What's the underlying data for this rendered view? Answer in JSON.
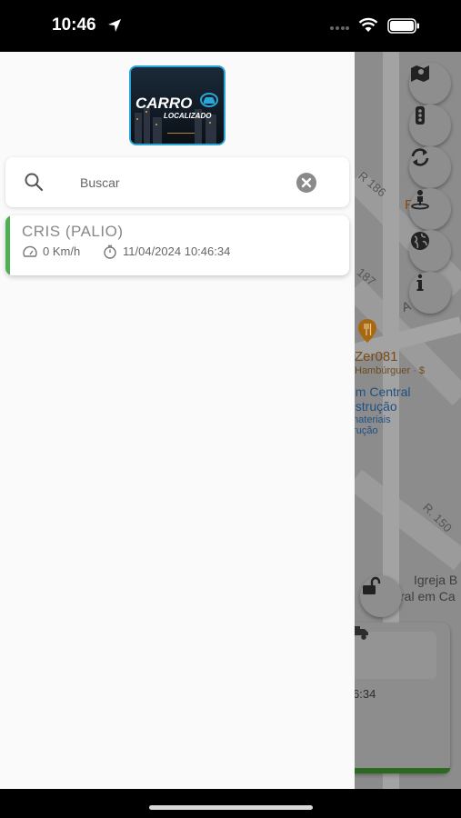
{
  "status_bar": {
    "time": "10:46",
    "icons": [
      "location-arrow-icon",
      "signal-dots-icon",
      "wifi-icon",
      "battery-icon"
    ]
  },
  "drawer": {
    "logo": {
      "line1": "CARRO",
      "line2": "LOCALIZADO"
    },
    "search": {
      "placeholder": "Buscar",
      "value": ""
    },
    "vehicles": [
      {
        "name": "CRIS (PALIO)",
        "speed": "0 Km/h",
        "last_update": "11/04/2024 10:46:34",
        "status_color": "#4caf50"
      }
    ]
  },
  "map": {
    "labels": {
      "street_186": "R 186",
      "street_187": "187",
      "street_150": "R. 150",
      "poi_name": "Zer081",
      "poi_category": "Hambúrguer · $",
      "place_line1": "ém Central",
      "place_line2": "nstrução",
      "place_line3": "materiais",
      "place_line4": "trução",
      "church_line1": "Igreja B",
      "church_line2": "ral em Ca",
      "partial_r": "R",
      "partial_a": "A"
    },
    "floating_buttons": [
      "map-icon",
      "traffic-light-icon",
      "refresh-icon",
      "person-pin-icon",
      "globe-icon",
      "info-icon"
    ],
    "bottom_card": {
      "time_fragment": "6:34",
      "progress_color": "#2a6a1e"
    }
  },
  "colors": {
    "accent_green": "#4caf50",
    "logo_border": "#2aa7d6"
  }
}
